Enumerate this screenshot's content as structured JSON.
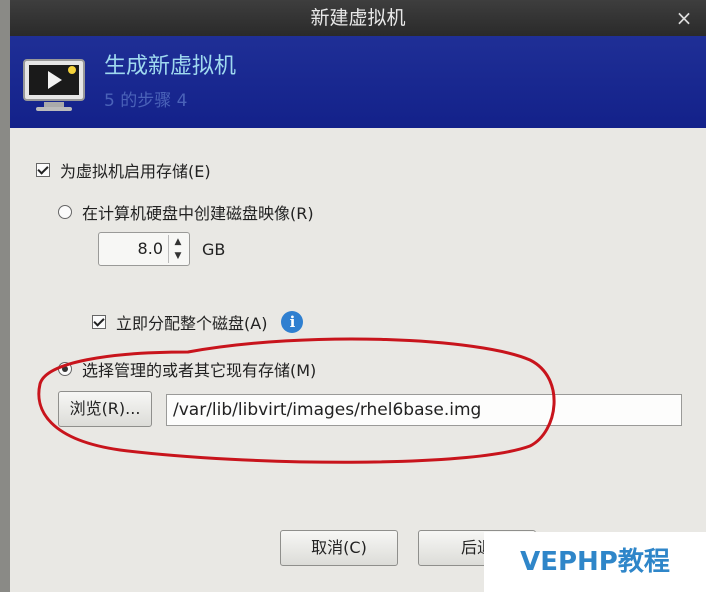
{
  "window": {
    "title": "新建虚拟机"
  },
  "banner": {
    "title": "生成新虚拟机",
    "step": "5 的步骤 4"
  },
  "storage": {
    "enable_label": "为虚拟机启用存储(E)",
    "enable_checked": true,
    "create_disk_label": "在计算机硬盘中创建磁盘映像(R)",
    "disk_size": "8.0",
    "disk_unit": "GB",
    "allocate_label": "立即分配整个磁盘(A)",
    "allocate_checked": true,
    "existing_label": "选择管理的或者其它现有存储(M)",
    "existing_selected": true,
    "browse_label": "浏览(R)...",
    "path_value": "/var/lib/libvirt/images/rhel6base.img"
  },
  "footer": {
    "cancel_label": "取消(C)",
    "back_label": "后退"
  },
  "watermark": "VEPHP教程",
  "icons": {
    "info": "i",
    "close": "×"
  },
  "colors": {
    "banner": "#13218a",
    "banner_title": "#9fd9ef",
    "annotation": "#c8141c",
    "watermark_text": "#2f86c9"
  }
}
